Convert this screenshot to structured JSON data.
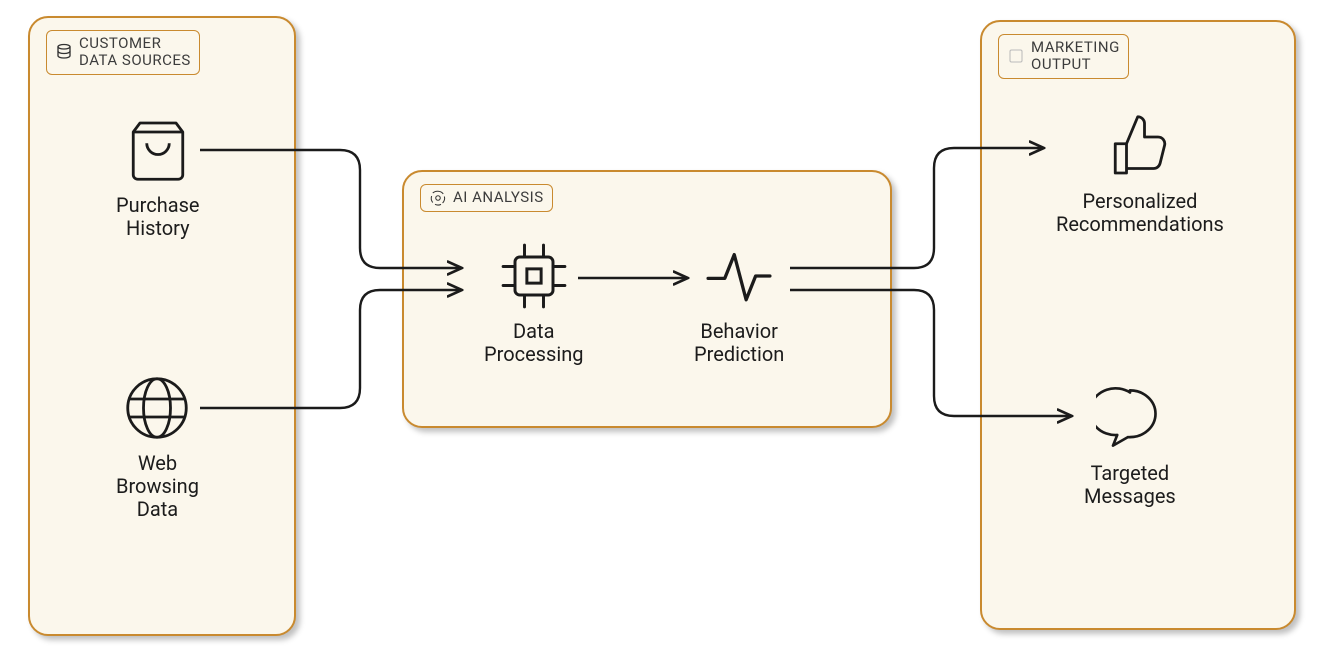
{
  "groups": {
    "inputs": {
      "title": "CUSTOMER\nDATA SOURCES"
    },
    "ai": {
      "title": "AI ANALYSIS"
    },
    "outputs": {
      "title": "MARKETING\nOUTPUT"
    }
  },
  "nodes": {
    "purchase": {
      "label": "Purchase\nHistory"
    },
    "browsing": {
      "label": "Web\nBrowsing\nData"
    },
    "processing": {
      "label": "Data\nProcessing"
    },
    "prediction": {
      "label": "Behavior\nPrediction"
    },
    "recs": {
      "label": "Personalized\nRecommendations"
    },
    "messages": {
      "label": "Targeted\nMessages"
    }
  },
  "colors": {
    "box_border": "#c98a2f",
    "box_fill": "#fbf7ec"
  }
}
